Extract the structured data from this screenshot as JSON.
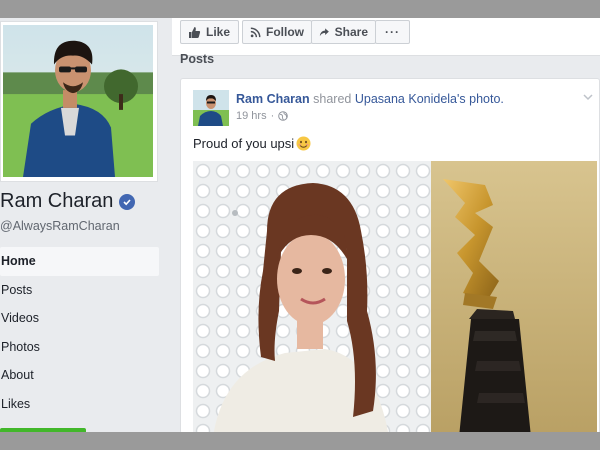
{
  "profile": {
    "name": "Ram Charan",
    "handle": "@AlwaysRamCharan",
    "verified": true
  },
  "sidebar": {
    "items": [
      {
        "label": "Home",
        "active": true
      },
      {
        "label": "Posts",
        "active": false
      },
      {
        "label": "Videos",
        "active": false
      },
      {
        "label": "Photos",
        "active": false
      },
      {
        "label": "About",
        "active": false
      },
      {
        "label": "Likes",
        "active": false
      }
    ]
  },
  "actions": {
    "like": "Like",
    "follow": "Follow",
    "share": "Share",
    "more": "···"
  },
  "posts_section": {
    "title": "Posts"
  },
  "post": {
    "author": "Ram Charan",
    "verb": "shared",
    "source_author": "Upasana Konidela",
    "source_suffix": "'s photo.",
    "time": "19 hrs",
    "meta_sep": "·",
    "text": "Proud of you upsi",
    "emoji_icon": "smile-icon",
    "privacy_icon": "globe-icon"
  },
  "colors": {
    "link": "#365899",
    "brand": "#4267b2",
    "accent_green": "#42b72a",
    "background": "#e9ebee"
  }
}
